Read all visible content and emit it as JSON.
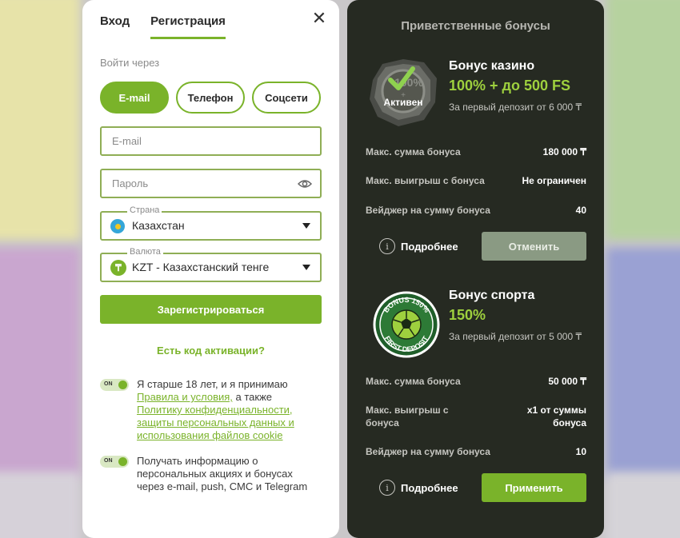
{
  "auth": {
    "tabs": [
      {
        "label": "Вход",
        "active": false
      },
      {
        "label": "Регистрация",
        "active": true
      }
    ],
    "close_icon": "close-icon",
    "login_via": "Войти через",
    "methods": [
      {
        "label": "E-mail",
        "active": true
      },
      {
        "label": "Телефон",
        "active": false
      },
      {
        "label": "Соцсети",
        "active": false
      }
    ],
    "email_placeholder": "E-mail",
    "password_placeholder": "Пароль",
    "country": {
      "legend": "Страна",
      "value": "Казахстан"
    },
    "currency": {
      "legend": "Валюта",
      "value": "KZT - Казахстанский тенге",
      "symbol": "₸"
    },
    "register_label": "Зарегистрироваться",
    "activation_label": "Есть код активации?",
    "toggle_on_label": "ON",
    "consent1": {
      "prefix": "Я старше 18 лет, и я принимаю",
      "link1": "Правила и условия,",
      "middle": " а также",
      "link2": "Политику конфиденциальности, защиты персональных данных и использования файлов cookie"
    },
    "consent2": "Получать информацию о персональных акциях и бонусах через e-mail, push, СМС и Telegram",
    "accent": "#7ab32a"
  },
  "bonuses": {
    "title": "Приветственные бонусы",
    "casino": {
      "badge_overlay": "Активен",
      "badge_text": "100%",
      "badge_plus": "+",
      "name": "Бонус казино",
      "amount": "100% + до 500 FS",
      "condition": "За первый депозит от 6 000 ₸",
      "rows": [
        {
          "label": "Макс. сумма бонуса",
          "value": "180 000 ₸"
        },
        {
          "label": "Макс. выигрыш с бонуса",
          "value": "Не ограничен"
        },
        {
          "label": "Вейджер на сумму бонуса",
          "value": "40"
        }
      ],
      "more": "Подробнее",
      "action": "Отменить"
    },
    "sport": {
      "badge_top": "BONUS 150%",
      "badge_bottom": "FIRST DEPOSIT",
      "name": "Бонус спорта",
      "amount": "150%",
      "condition": "За первый депозит от 5 000 ₸",
      "rows": [
        {
          "label": "Макс. сумма бонуса",
          "value": "50 000 ₸"
        },
        {
          "label": "Макс. выигрыш с бонуса",
          "value": "x1 от суммы бонуса"
        },
        {
          "label": "Вейджер на сумму бонуса",
          "value": "10"
        }
      ],
      "more": "Подробнее",
      "action": "Применить"
    }
  }
}
